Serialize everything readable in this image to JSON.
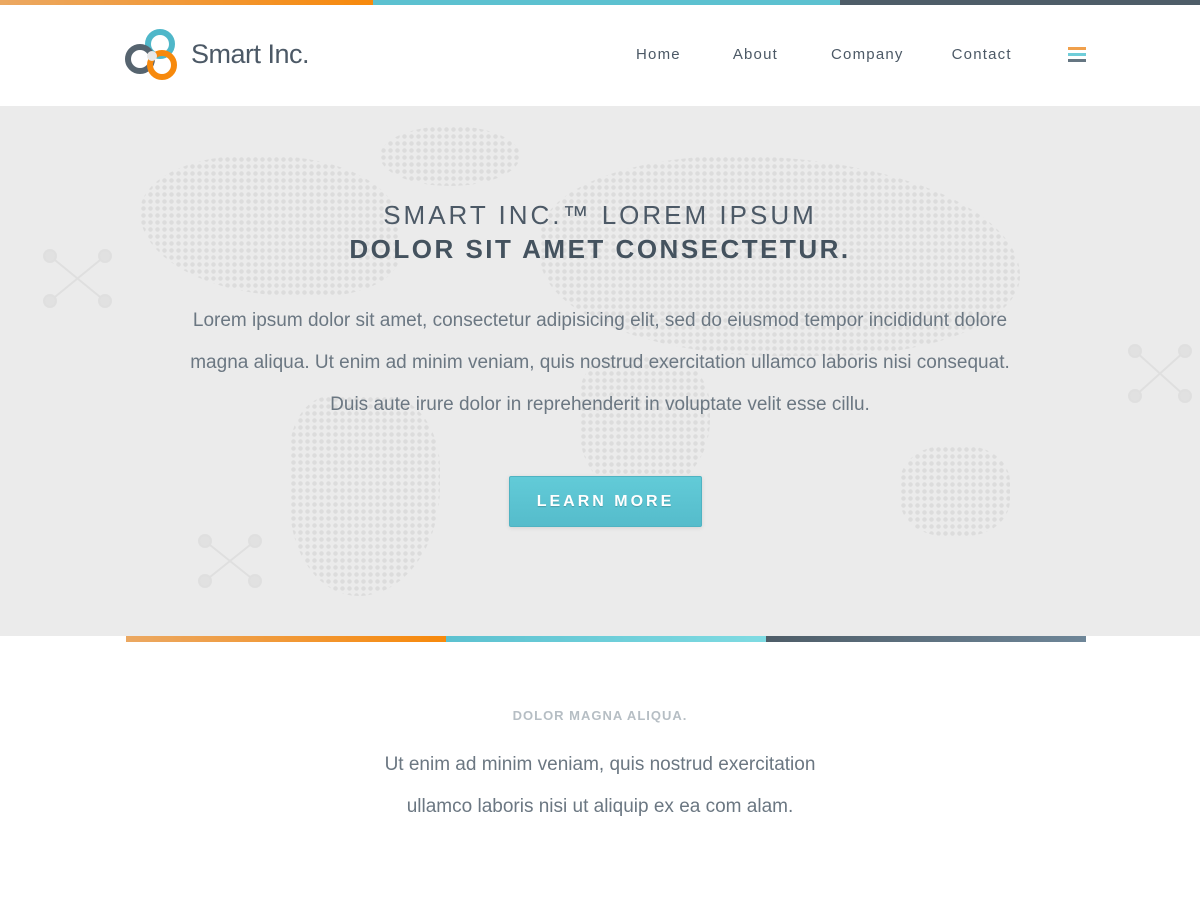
{
  "colors": {
    "orange": "#f7890c",
    "teal": "#5cc1d0",
    "slate": "#4e5d68"
  },
  "brand": {
    "name": "Smart Inc.",
    "logo_icon": "three-rings-logo-icon"
  },
  "nav": {
    "items": [
      {
        "label": "Home"
      },
      {
        "label": "About"
      },
      {
        "label": "Company"
      },
      {
        "label": "Contact"
      }
    ],
    "menu_icon": "hamburger-icon"
  },
  "hero": {
    "title_line1": "SMART INC.™ LOREM IPSUM",
    "title_line2": "DOLOR SIT AMET CONSECTETUR.",
    "lead": "Lorem ipsum dolor sit amet, consectetur adipisicing elit, sed do eiusmod tempor incididunt dolore magna aliqua. Ut enim ad minim veniam, quis nostrud exercitation ullamco laboris nisi consequat. Duis aute irure dolor in reprehenderit in voluptate velit esse cillu.",
    "cta_label": "LEARN MORE",
    "background": "dotted-world-map"
  },
  "section": {
    "eyebrow": "DOLOR MAGNA ALIQUA.",
    "text": "Ut enim ad minim veniam, quis nostrud exercitation ullamco laboris nisi ut aliquip ex ea com alam."
  }
}
